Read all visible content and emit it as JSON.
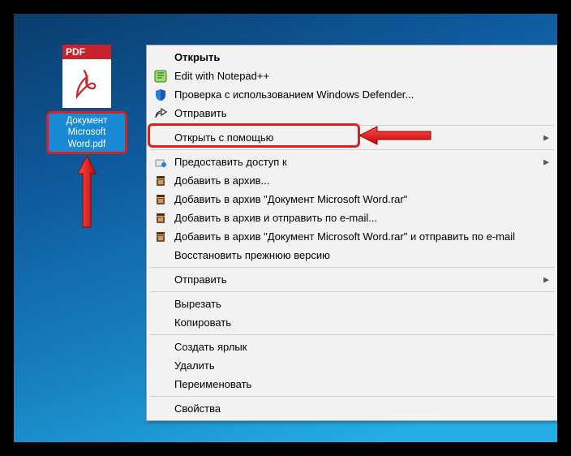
{
  "file": {
    "badge": "PDF",
    "label": "Документ Microsoft Word.pdf"
  },
  "menu": {
    "items": [
      {
        "label": "Открыть",
        "bold": true
      },
      {
        "label": "Edit with Notepad++",
        "icon": "notepad"
      },
      {
        "label": "Проверка с использованием Windows Defender...",
        "icon": "shield"
      },
      {
        "label": "Отправить",
        "icon": "share"
      }
    ],
    "items2": [
      {
        "label": "Открыть с помощью",
        "submenu": true
      }
    ],
    "items3": [
      {
        "label": "Предоставить доступ к",
        "icon": "give",
        "submenu": true
      },
      {
        "label": "Добавить в архив...",
        "icon": "rar"
      },
      {
        "label": "Добавить в архив \"Документ Microsoft Word.rar\"",
        "icon": "rar"
      },
      {
        "label": "Добавить в архив и отправить по e-mail...",
        "icon": "rar"
      },
      {
        "label": "Добавить в архив \"Документ Microsoft Word.rar\" и отправить по e-mail",
        "icon": "rar"
      },
      {
        "label": "Восстановить прежнюю версию"
      }
    ],
    "items4": [
      {
        "label": "Отправить",
        "submenu": true
      }
    ],
    "items5": [
      {
        "label": "Вырезать"
      },
      {
        "label": "Копировать"
      }
    ],
    "items6": [
      {
        "label": "Создать ярлык"
      },
      {
        "label": "Удалить"
      },
      {
        "label": "Переименовать"
      }
    ],
    "items7": [
      {
        "label": "Свойства"
      }
    ]
  }
}
